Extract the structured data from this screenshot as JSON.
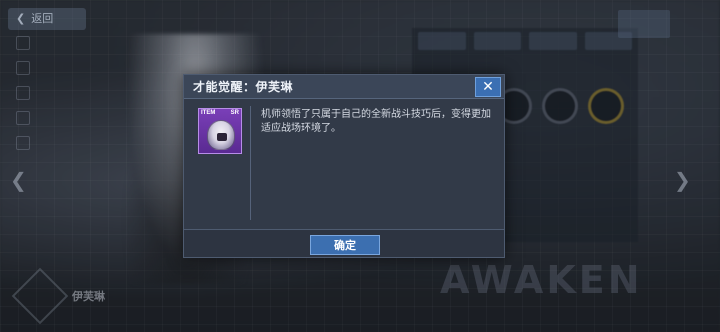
{
  "background": {
    "back_label": "返回",
    "watermark_text": "AWAKEN",
    "character_name": "伊芙琳"
  },
  "dialog": {
    "title": "才能觉醒：伊芙琳",
    "close_symbol": "✕",
    "item": {
      "type_label": "ITEM",
      "rarity_label": "SR",
      "icon": "character-portrait-icon"
    },
    "description": "机师领悟了只属于自己的全新战斗技巧后，变得更加适应战场环境了。",
    "confirm_label": "确定"
  },
  "colors": {
    "dialog_bg": "#323a48",
    "header_bg": "#3b4658",
    "button_blue": "#3c6fb0",
    "item_purple": "#6a34a8"
  }
}
